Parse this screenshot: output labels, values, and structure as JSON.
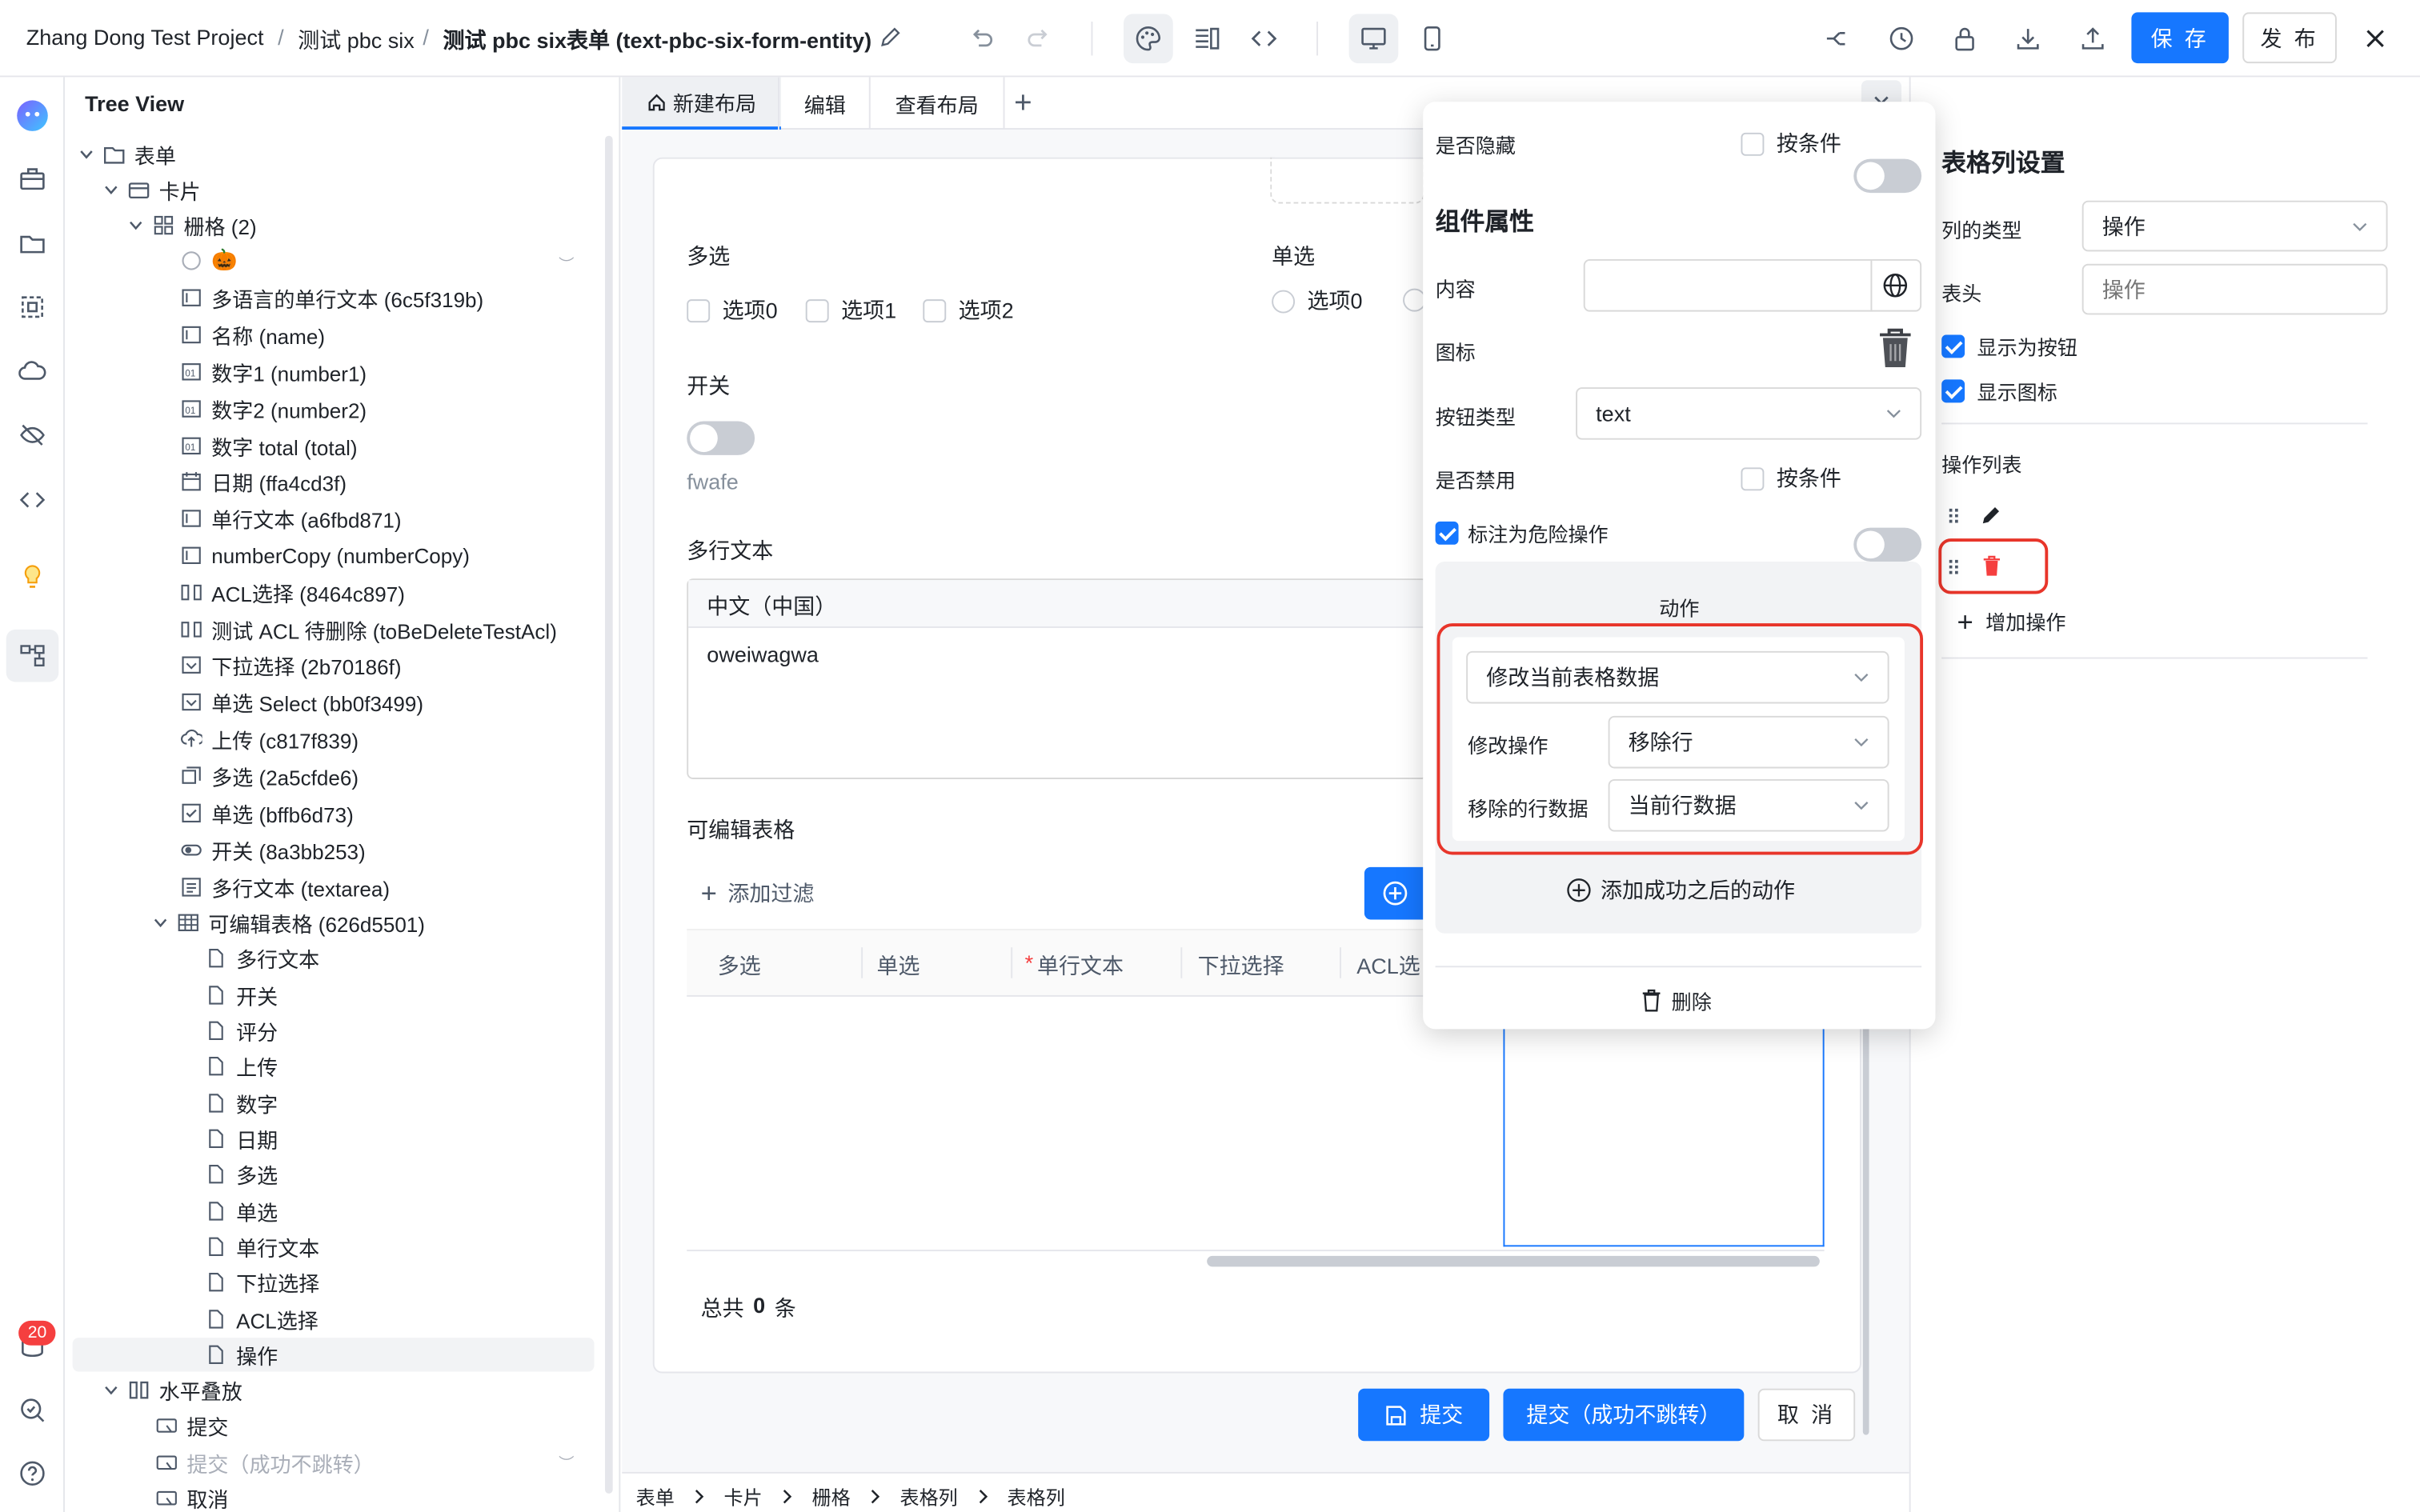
{
  "topbar": {
    "project": "Zhang Dong Test Project",
    "sep": "/",
    "app": "测试 pbc six",
    "form_title": "测试 pbc six表单 (text-pbc-six-form-entity)",
    "save_label": "保 存",
    "publish_label": "发 布"
  },
  "rail": {
    "badge": "20"
  },
  "tree": {
    "title": "Tree View",
    "nodes": [
      {
        "label": "表单"
      },
      {
        "label": "卡片"
      },
      {
        "label": "栅格 (2)"
      },
      {
        "label": "🎃"
      },
      {
        "label": "多语言的单行文本 (6c5f319b)"
      },
      {
        "label": "名称 (name)"
      },
      {
        "label": "数字1 (number1)"
      },
      {
        "label": "数字2 (number2)"
      },
      {
        "label": "数字 total (total)"
      },
      {
        "label": "日期 (ffa4cd3f)"
      },
      {
        "label": "单行文本 (a6fbd871)"
      },
      {
        "label": "numberCopy (numberCopy)"
      },
      {
        "label": "ACL选择 (8464c897)"
      },
      {
        "label": "测试 ACL 待删除 (toBeDeleteTestAcl)"
      },
      {
        "label": "下拉选择 (2b70186f)"
      },
      {
        "label": "单选 Select (bb0f3499)"
      },
      {
        "label": "上传 (c817f839)"
      },
      {
        "label": "多选 (2a5cfde6)"
      },
      {
        "label": "单选 (bffb6d73)"
      },
      {
        "label": "开关 (8a3bb253)"
      },
      {
        "label": "多行文本 (textarea)"
      },
      {
        "label": "可编辑表格 (626d5501)"
      },
      {
        "label": "多行文本"
      },
      {
        "label": "开关"
      },
      {
        "label": "评分"
      },
      {
        "label": "上传"
      },
      {
        "label": "数字"
      },
      {
        "label": "日期"
      },
      {
        "label": "多选"
      },
      {
        "label": "单选"
      },
      {
        "label": "单行文本"
      },
      {
        "label": "下拉选择"
      },
      {
        "label": "ACL选择"
      },
      {
        "label": "操作"
      },
      {
        "label": "水平叠放"
      },
      {
        "label": "提交"
      },
      {
        "label": "提交（成功不跳转）"
      },
      {
        "label": "取消"
      }
    ]
  },
  "tabs": [
    {
      "label": "新建布局"
    },
    {
      "label": "编辑"
    },
    {
      "label": "查看布局"
    }
  ],
  "form": {
    "multi_label": "多选",
    "multi_options": [
      "选项0",
      "选项1",
      "选项2"
    ],
    "single_label": "单选",
    "single_options": [
      "选项0"
    ],
    "switch_label": "开关",
    "switch_caption": "fwafe",
    "textarea_label": "多行文本",
    "textarea_lang": "中文（中国）",
    "textarea_value": "oweiwagwa",
    "table_label": "可编辑表格",
    "add_filter": "添加过滤",
    "table_columns": [
      "多选",
      "单选",
      "单行文本",
      "下拉选择",
      "ACL选"
    ],
    "required_mark": "*",
    "total_prefix": "总共",
    "total_count": "0",
    "total_suffix": "条",
    "submit": "提交",
    "submit_stay": "提交（成功不跳转）",
    "cancel": "取 消"
  },
  "breadcrumb": [
    "表单",
    "卡片",
    "栅格",
    "表格列",
    "表格列"
  ],
  "popover": {
    "hidden_label": "是否隐藏",
    "condition_label": "按条件",
    "section_title": "组件属性",
    "content_label": "内容",
    "icon_label": "图标",
    "btn_type_label": "按钮类型",
    "btn_type_value": "text",
    "disabled_label": "是否禁用",
    "danger_label": "标注为危险操作",
    "action_title": "动作",
    "action_select": "修改当前表格数据",
    "modify_label": "修改操作",
    "modify_value": "移除行",
    "removed_label": "移除的行数据",
    "removed_value": "当前行数据",
    "add_after": "添加成功之后的动作",
    "delete_label": "删除"
  },
  "right": {
    "title": "表格列设置",
    "col_type_label": "列的类型",
    "col_type_value": "操作",
    "header_label": "表头",
    "header_placeholder": "操作",
    "show_button": "显示为按钮",
    "show_icon": "显示图标",
    "ops_title": "操作列表",
    "add_op": "增加操作"
  },
  "colors": {
    "primary": "#1677ff",
    "danger": "#f53f3f",
    "highlight": "#e8352a"
  }
}
